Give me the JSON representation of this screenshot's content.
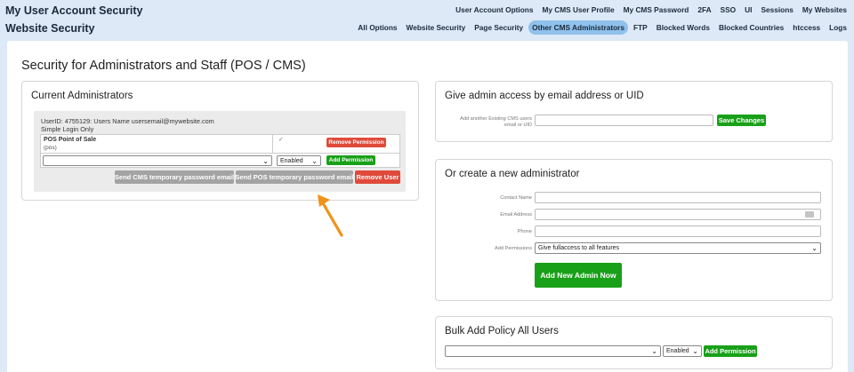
{
  "header": {
    "row1_title": "My User Account Security",
    "row2_title": "Website Security",
    "nav1": [
      "User Account Options",
      "My CMS User Profile",
      "My CMS Password",
      "2FA",
      "SSO",
      "UI",
      "Sessions",
      "My Websites"
    ],
    "nav2": [
      "All Options",
      "Website Security",
      "Page Security",
      "Other CMS Administrators",
      "FTP",
      "Blocked Words",
      "Blocked Countries",
      "htccess",
      "Logs"
    ],
    "active_nav2": "Other CMS Administrators"
  },
  "page_title": "Security for Administrators and Staff (POS / CMS)",
  "current_admins": {
    "title": "Current Administrators",
    "user_line": "UserID: 4755129: Users Name usersemail@mywebsite.com",
    "login_type": "Simple Login Only",
    "permission_name": "POS Point of Sale",
    "permission_code": "(pos)",
    "check_mark": "✓",
    "remove_permission_label": "Remove Permission",
    "permission_select_value": "",
    "status_select_value": "Enabled",
    "add_permission_label": "Add Permission",
    "send_cms_label": "Send CMS temporary password email",
    "send_pos_label": "Send POS temporary password email",
    "remove_user_label": "Remove User"
  },
  "give_access": {
    "title": "Give admin access by email address or UID",
    "field_label": "Add another Existing CMS users email or UID",
    "field_value": "",
    "save_label": "Save Changes"
  },
  "create_admin": {
    "title": "Or create a new administrator",
    "contact_name_label": "Contact Name",
    "email_label": "Email Address",
    "phone_label": "Phone",
    "permissions_label": "Add Permissions",
    "permissions_value": "Give fullaccess to all features",
    "submit_label": "Add New Admin Now"
  },
  "bulk_add": {
    "title": "Bulk Add Policy All Users",
    "policy_value": "",
    "status_value": "Enabled",
    "add_permission_label": "Add Permission"
  },
  "colors": {
    "accent_blue": "#8fc1ec",
    "green": "#19a019",
    "red": "#e04a3a",
    "gray": "#a3a3a3",
    "arrow": "#f0921c"
  },
  "icons": {
    "dropdown": "chevron-down-icon",
    "annotation": "arrow-icon",
    "contact_card": "contact-card-icon"
  }
}
